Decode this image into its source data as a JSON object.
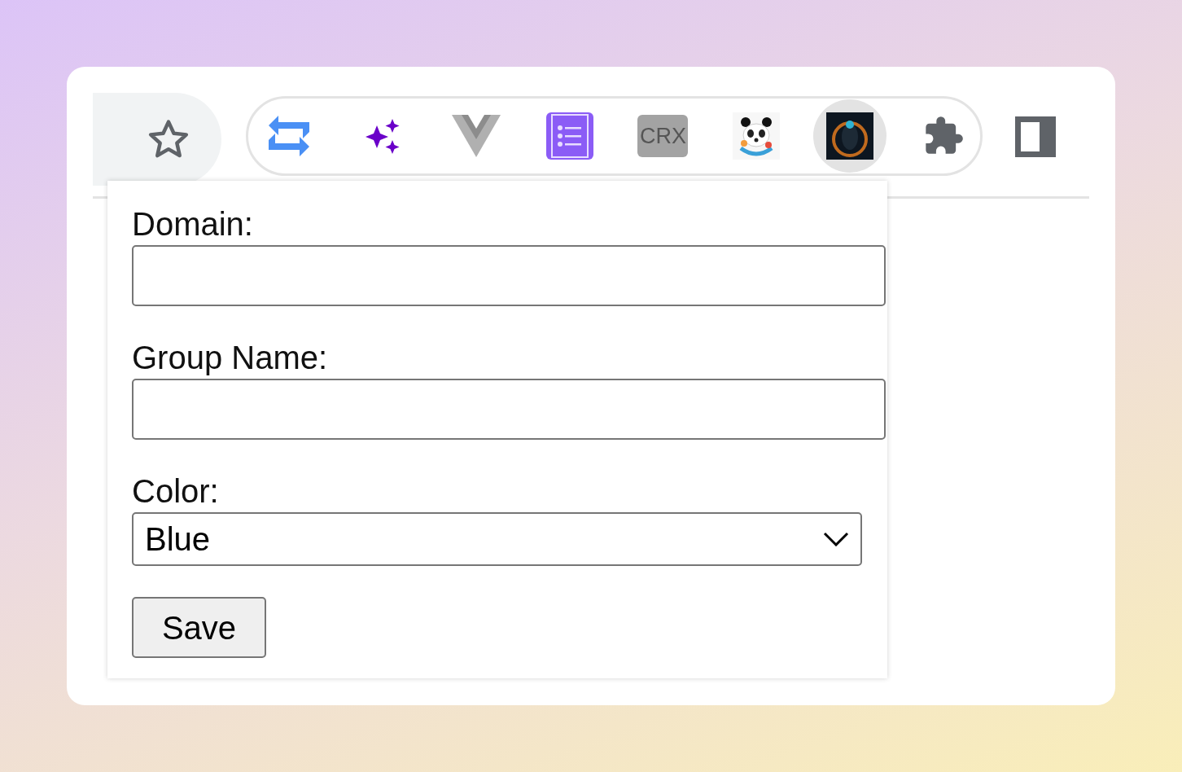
{
  "toolbar": {
    "bookmark_star": {
      "selected": true
    },
    "extensions": [
      {
        "kind": "arrows",
        "selected": false
      },
      {
        "kind": "sparkles",
        "selected": false
      },
      {
        "kind": "v-logo",
        "selected": false
      },
      {
        "kind": "list",
        "selected": false
      },
      {
        "kind": "crx",
        "label": "CRX",
        "selected": false
      },
      {
        "kind": "panda",
        "selected": false
      },
      {
        "kind": "dark-image",
        "selected": true
      }
    ]
  },
  "popup": {
    "fields": [
      {
        "kind": "text",
        "label": "Domain:"
      },
      {
        "kind": "text",
        "label": "Group Name:"
      },
      {
        "kind": "select",
        "label": "Color:",
        "value": "Blue"
      }
    ],
    "button": "Save"
  }
}
